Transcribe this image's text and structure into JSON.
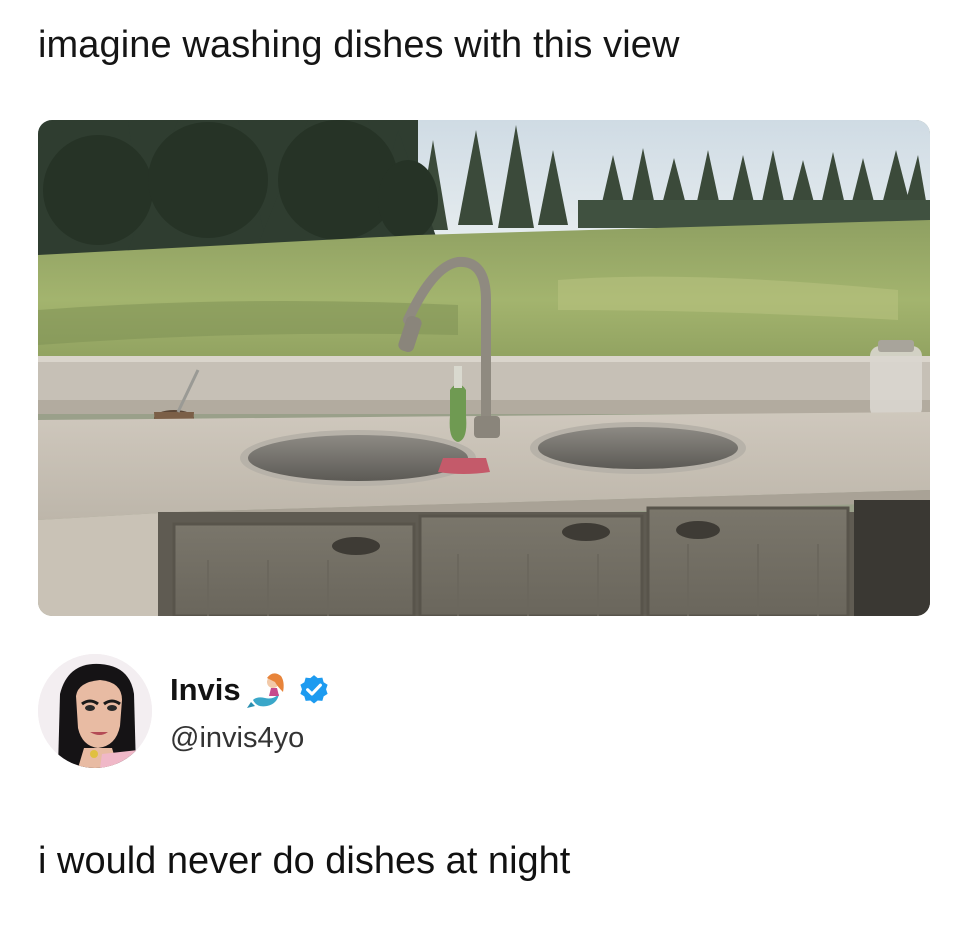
{
  "post": {
    "caption": "imagine washing dishes with this view",
    "media": {
      "alt": "kitchen sink in front of a large window overlooking a grassy field with trees"
    }
  },
  "tweet": {
    "author": {
      "display_name": "Invis",
      "handle": "@invis4yo",
      "name_emoji_icon": "mermaid-icon",
      "verified_icon": "verified-badge-icon",
      "verified_color": "#1d9bf0"
    },
    "text": "i would never do dishes at night"
  }
}
